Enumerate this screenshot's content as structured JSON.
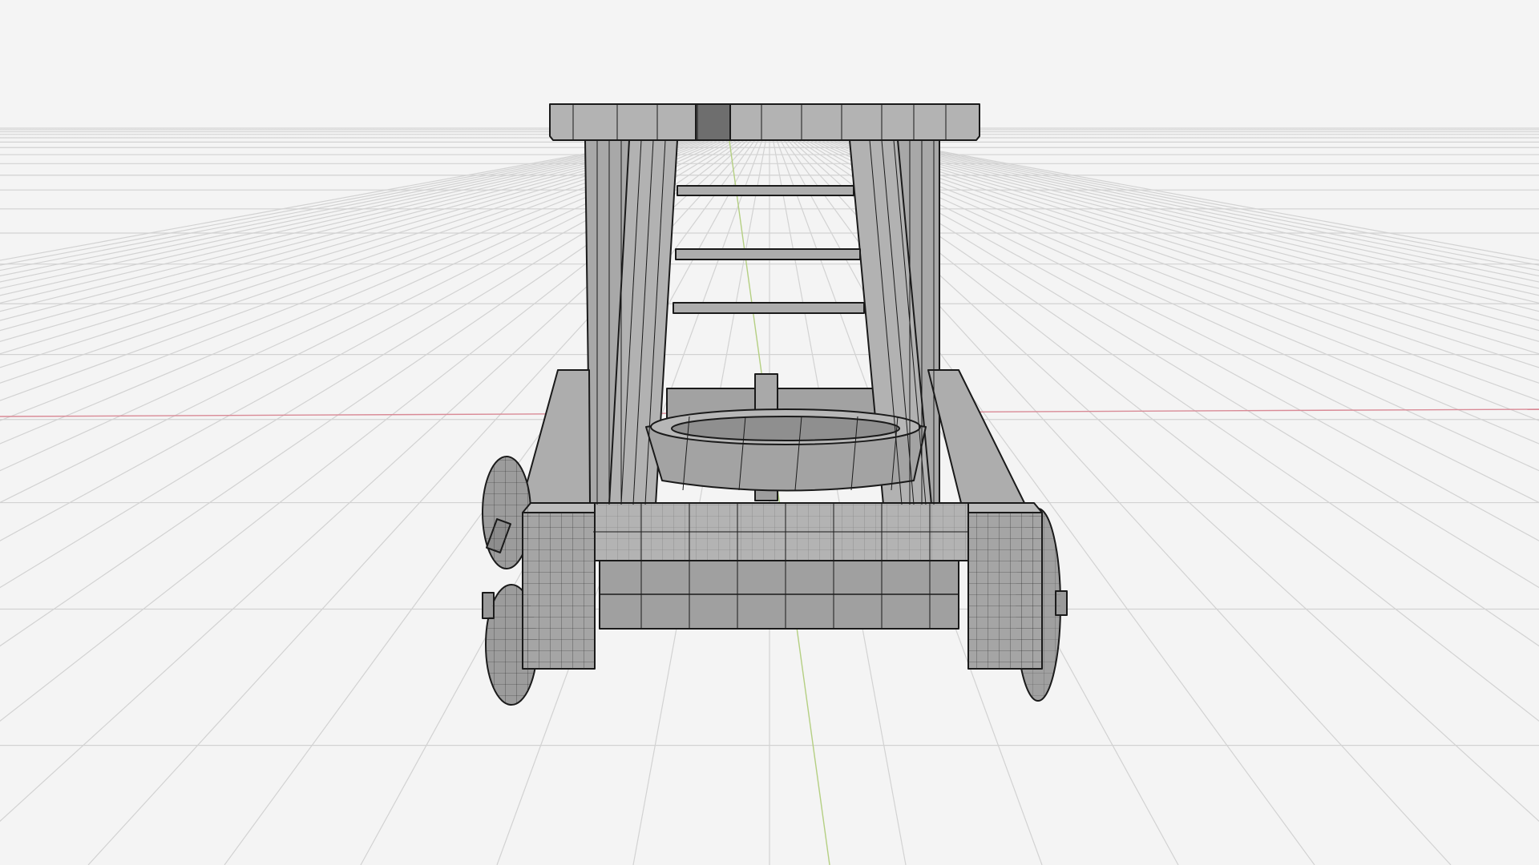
{
  "viewport": {
    "mode": "wireframe-solid",
    "background_color": "#f4f4f4",
    "grid_color": "#d4d4d4",
    "x_axis_color": "#d98a96",
    "y_axis_color": "#a8c878"
  },
  "model": {
    "subject": "catapult",
    "fill_color": "#a9a9a9",
    "wire_color": "#1a1a1a"
  }
}
